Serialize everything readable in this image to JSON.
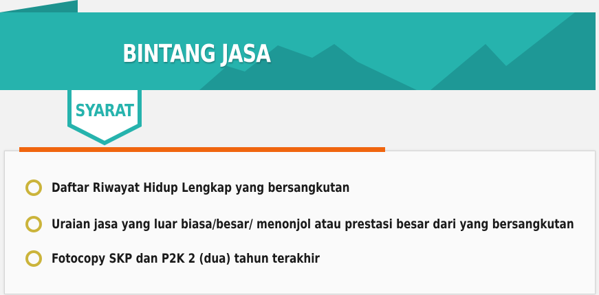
{
  "banner": {
    "title": "BINTANG JASA",
    "colors": {
      "primary": "#26b3ad",
      "shade": "#1e9896"
    }
  },
  "tag": {
    "label": "SYARAT"
  },
  "accent_color": "#f0650e",
  "requirements": [
    "Daftar Riwayat Hidup Lengkap yang bersangkutan",
    "Uraian jasa yang luar biasa/besar/ menonjol atau prestasi besar dari yang bersangkutan",
    "Fotocopy SKP dan P2K 2 (dua) tahun terakhir"
  ]
}
